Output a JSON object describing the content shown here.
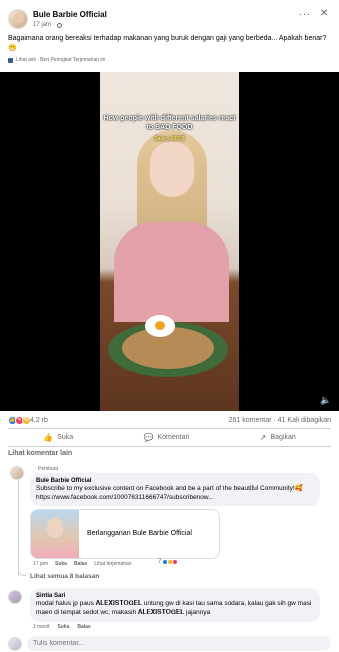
{
  "post": {
    "page_name": "Bule Barbie Official",
    "time": "17 jam",
    "caption": "Bagaimana orang bereaksi terhadap makanan yang buruk dengan gaji yang berbeda... Apakah benar? 😬",
    "translate": "Lihat asli · Beri Peringkat Terjemahan ini",
    "more_icon": "more-icon",
    "close_icon": "close-icon"
  },
  "video": {
    "title": "How people with different salaries react to BAD FOOD",
    "subtitle": "Salary 3000$"
  },
  "stats": {
    "reactions": "4,2 rb",
    "comments_shares": "261 komentar · 41 Kali dibagikan"
  },
  "actions": {
    "like": "Suka",
    "comment": "Komentari",
    "share": "Bagikan"
  },
  "comments": {
    "other_label": "Lihat komentar lain",
    "c1": {
      "tag": "Pembuat",
      "author": "Bule Barbie Official",
      "text": "Subscribe to my exclusive content on Facebook and be a part of the beautiful Community!🥰 https://www.facebook.com/100076311666747/subscribenow...",
      "preview_text": "Berlangganan Bule Barbie Official",
      "time": "17 jam",
      "like": "Suka",
      "reply": "Balas",
      "translation": "Lihat terjemahan",
      "reaction_count": "7",
      "see_replies": "Lihat semua 8 balasan"
    },
    "c2": {
      "author": "Sintia Sari",
      "text": "modal halus jp paus 𝐀𝐋𝐄𝐗𝐈𝐒𝐓𝐎𝐆𝐄𝐋 untung gw di kasi tau sama sodara, kalau gak sih gw masi maen di tempat sedot wc, makasih 𝐀𝐋𝐄𝐗𝐈𝐒𝐓𝐎𝐆𝐄𝐋 jajannya",
      "time": "1 menit",
      "like": "Suka",
      "reply": "Balas"
    }
  },
  "write": {
    "placeholder": "Tulis komentar..."
  },
  "colors": {
    "brand": "#1877f2",
    "muted_text": "#65676b",
    "bubble": "#f0f2f5"
  }
}
